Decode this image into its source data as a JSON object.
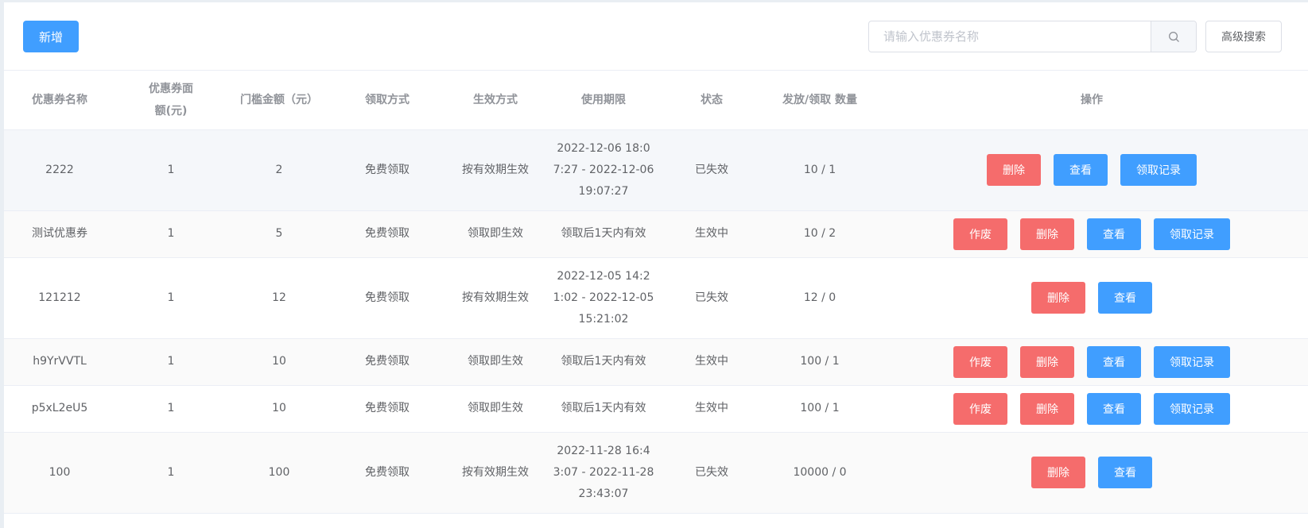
{
  "toolbar": {
    "add_label": "新增",
    "search_placeholder": "请输入优惠券名称",
    "advanced_search_label": "高级搜索",
    "search_icon": "search-icon"
  },
  "table": {
    "columns": {
      "name": "优惠券名称",
      "face_value": "优惠券面额(元)",
      "threshold": "门槛金额（元）",
      "claim_method": "领取方式",
      "effect_method": "生效方式",
      "period": "使用期限",
      "status": "状态",
      "issued_claimed": "发放/领取 数量",
      "actions": "操作"
    },
    "rows": [
      {
        "name": "2222",
        "face_value": "1",
        "threshold": "2",
        "claim_method": "免费领取",
        "effect_method": "按有效期生效",
        "period": "2022-12-06 18:07:27 - 2022-12-06 19:07:27",
        "status": "已失效",
        "count": "10 / 1"
      },
      {
        "name": "测试优惠券",
        "face_value": "1",
        "threshold": "5",
        "claim_method": "免费领取",
        "effect_method": "领取即生效",
        "period": "领取后1天内有效",
        "status": "生效中",
        "count": "10 / 2"
      },
      {
        "name": "121212",
        "face_value": "1",
        "threshold": "12",
        "claim_method": "免费领取",
        "effect_method": "按有效期生效",
        "period": "2022-12-05 14:21:02 - 2022-12-05 15:21:02",
        "status": "已失效",
        "count": "12 / 0"
      },
      {
        "name": "h9YrVVTL",
        "face_value": "1",
        "threshold": "10",
        "claim_method": "免费领取",
        "effect_method": "领取即生效",
        "period": "领取后1天内有效",
        "status": "生效中",
        "count": "100 / 1"
      },
      {
        "name": "p5xL2eU5",
        "face_value": "1",
        "threshold": "10",
        "claim_method": "免费领取",
        "effect_method": "领取即生效",
        "period": "领取后1天内有效",
        "status": "生效中",
        "count": "100 / 1"
      },
      {
        "name": "100",
        "face_value": "1",
        "threshold": "100",
        "claim_method": "免费领取",
        "effect_method": "按有效期生效",
        "period": "2022-11-28 16:43:07 - 2022-11-28 23:43:07",
        "status": "已失效",
        "count": "10000 / 0"
      }
    ],
    "actions": {
      "void": "作废",
      "delete": "删除",
      "view": "查看",
      "records": "领取记录"
    }
  },
  "colors": {
    "primary": "#409eff",
    "danger": "#f56c6c"
  }
}
